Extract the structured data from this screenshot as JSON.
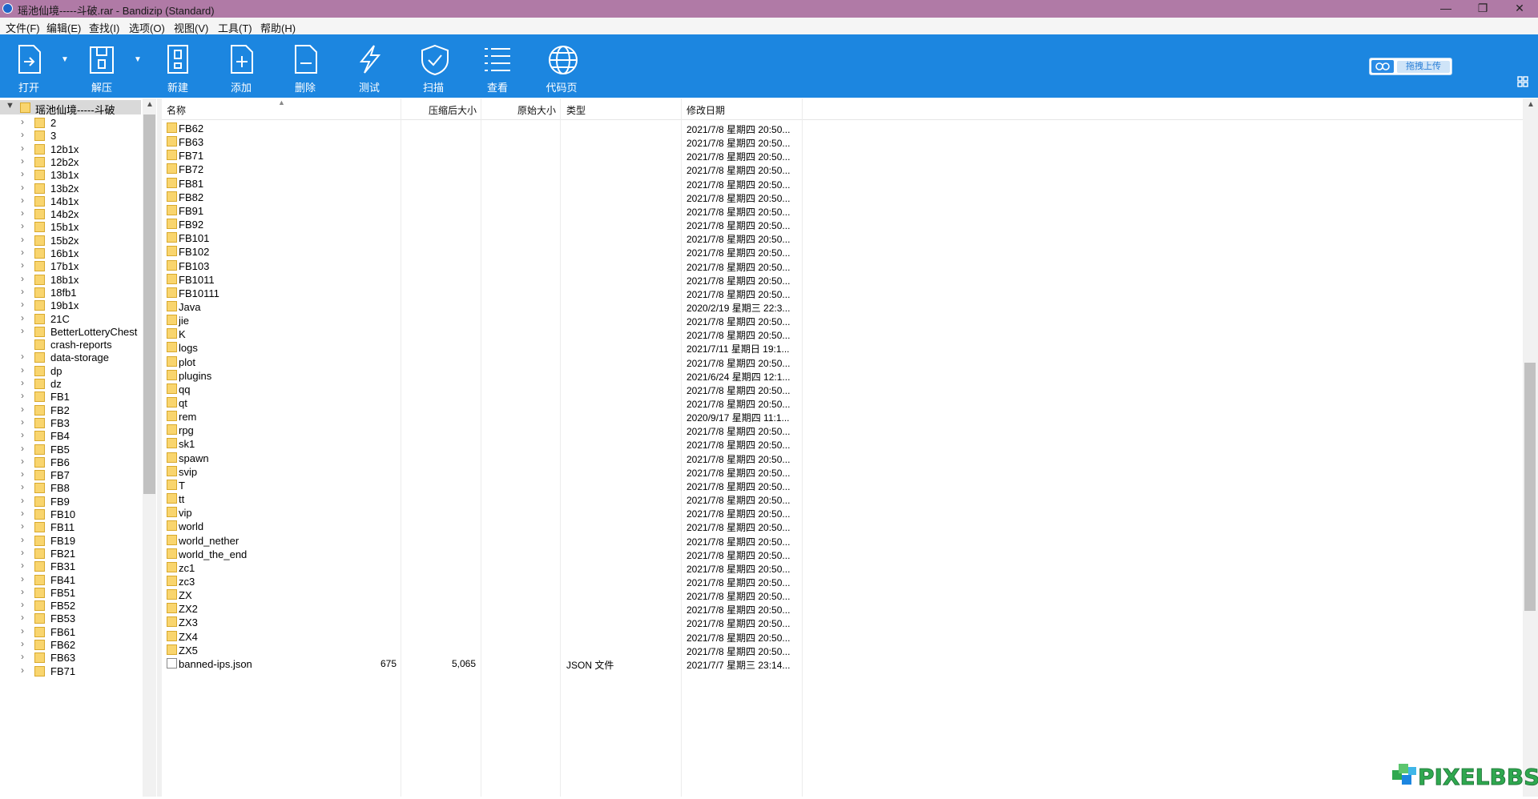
{
  "window": {
    "title": "瑶池仙境-----斗破.rar - Bandizip (Standard)",
    "minimize": "—",
    "maximize": "❐",
    "close": "✕"
  },
  "menu": [
    "文件(F)",
    "编辑(E)",
    "查找(I)",
    "选项(O)",
    "视图(V)",
    "工具(T)",
    "帮助(H)"
  ],
  "toolbar": {
    "open": "打开",
    "extract": "解压",
    "new": "新建",
    "add": "添加",
    "delete": "删除",
    "test": "测试",
    "scan": "扫描",
    "view": "查看",
    "codepage": "代码页",
    "upload": "拖拽上传"
  },
  "tree": {
    "root": "瑶池仙境-----斗破",
    "items": [
      "2",
      "3",
      "12b1x",
      "12b2x",
      "13b1x",
      "13b2x",
      "14b1x",
      "14b2x",
      "15b1x",
      "15b2x",
      "16b1x",
      "17b1x",
      "18b1x",
      "18fb1",
      "19b1x",
      "21C",
      "BetterLotteryChest",
      "crash-reports",
      "data-storage",
      "dp",
      "dz",
      "FB1",
      "FB2",
      "FB3",
      "FB4",
      "FB5",
      "FB6",
      "FB7",
      "FB8",
      "FB9",
      "FB10",
      "FB11",
      "FB19",
      "FB21",
      "FB31",
      "FB41",
      "FB51",
      "FB52",
      "FB53",
      "FB61",
      "FB62",
      "FB63",
      "FB71"
    ]
  },
  "columns": {
    "name": "名称",
    "compressed": "压缩后大小",
    "original": "原始大小",
    "type": "类型",
    "modified": "修改日期"
  },
  "files": [
    {
      "name": "FB62",
      "date": "2021/7/8 星期四 20:50..."
    },
    {
      "name": "FB63",
      "date": "2021/7/8 星期四 20:50..."
    },
    {
      "name": "FB71",
      "date": "2021/7/8 星期四 20:50..."
    },
    {
      "name": "FB72",
      "date": "2021/7/8 星期四 20:50..."
    },
    {
      "name": "FB81",
      "date": "2021/7/8 星期四 20:50..."
    },
    {
      "name": "FB82",
      "date": "2021/7/8 星期四 20:50..."
    },
    {
      "name": "FB91",
      "date": "2021/7/8 星期四 20:50..."
    },
    {
      "name": "FB92",
      "date": "2021/7/8 星期四 20:50..."
    },
    {
      "name": "FB101",
      "date": "2021/7/8 星期四 20:50..."
    },
    {
      "name": "FB102",
      "date": "2021/7/8 星期四 20:50..."
    },
    {
      "name": "FB103",
      "date": "2021/7/8 星期四 20:50..."
    },
    {
      "name": "FB1011",
      "date": "2021/7/8 星期四 20:50..."
    },
    {
      "name": "FB10111",
      "date": "2021/7/8 星期四 20:50..."
    },
    {
      "name": "Java",
      "date": "2020/2/19 星期三 22:3..."
    },
    {
      "name": "jie",
      "date": "2021/7/8 星期四 20:50..."
    },
    {
      "name": "K",
      "date": "2021/7/8 星期四 20:50..."
    },
    {
      "name": "logs",
      "date": "2021/7/11 星期日 19:1..."
    },
    {
      "name": "plot",
      "date": "2021/7/8 星期四 20:50..."
    },
    {
      "name": "plugins",
      "date": "2021/6/24 星期四 12:1..."
    },
    {
      "name": "qq",
      "date": "2021/7/8 星期四 20:50..."
    },
    {
      "name": "qt",
      "date": "2021/7/8 星期四 20:50..."
    },
    {
      "name": "rem",
      "date": "2020/9/17 星期四 11:1..."
    },
    {
      "name": "rpg",
      "date": "2021/7/8 星期四 20:50..."
    },
    {
      "name": "sk1",
      "date": "2021/7/8 星期四 20:50..."
    },
    {
      "name": "spawn",
      "date": "2021/7/8 星期四 20:50..."
    },
    {
      "name": "svip",
      "date": "2021/7/8 星期四 20:50..."
    },
    {
      "name": "T",
      "date": "2021/7/8 星期四 20:50..."
    },
    {
      "name": "tt",
      "date": "2021/7/8 星期四 20:50..."
    },
    {
      "name": "vip",
      "date": "2021/7/8 星期四 20:50..."
    },
    {
      "name": "world",
      "date": "2021/7/8 星期四 20:50..."
    },
    {
      "name": "world_nether",
      "date": "2021/7/8 星期四 20:50..."
    },
    {
      "name": "world_the_end",
      "date": "2021/7/8 星期四 20:50..."
    },
    {
      "name": "zc1",
      "date": "2021/7/8 星期四 20:50..."
    },
    {
      "name": "zc3",
      "date": "2021/7/8 星期四 20:50..."
    },
    {
      "name": "ZX",
      "date": "2021/7/8 星期四 20:50..."
    },
    {
      "name": "ZX2",
      "date": "2021/7/8 星期四 20:50..."
    },
    {
      "name": "ZX3",
      "date": "2021/7/8 星期四 20:50..."
    },
    {
      "name": "ZX4",
      "date": "2021/7/8 星期四 20:50..."
    },
    {
      "name": "ZX5",
      "date": "2021/7/8 星期四 20:50..."
    },
    {
      "name": "banned-ips.json",
      "date": "2021/7/7 星期三 23:14...",
      "compressed": "675",
      "original": "5,065",
      "type": "JSON 文件",
      "is_file": true
    }
  ],
  "watermark": "PIXELBBS",
  "colors": {
    "titlebar": "#b07aa6",
    "toolbar": "#1c86e0",
    "folder": "#f9d56e"
  }
}
